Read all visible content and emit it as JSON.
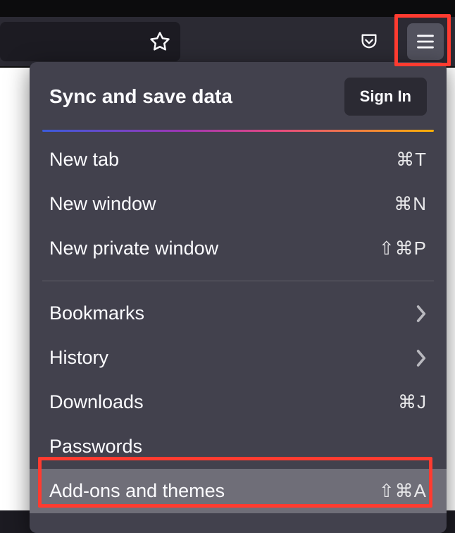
{
  "toolbar": {
    "star_icon": "star",
    "pocket_icon": "pocket",
    "menu_icon": "hamburger"
  },
  "menu": {
    "sync_title": "Sync and save data",
    "sign_in_label": "Sign In",
    "items_group1": [
      {
        "label": "New tab",
        "shortcut": "⌘T"
      },
      {
        "label": "New window",
        "shortcut": "⌘N"
      },
      {
        "label": "New private window",
        "shortcut": "⇧⌘P"
      }
    ],
    "items_group2": [
      {
        "label": "Bookmarks",
        "submenu": true
      },
      {
        "label": "History",
        "submenu": true
      },
      {
        "label": "Downloads",
        "shortcut": "⌘J"
      },
      {
        "label": "Passwords"
      },
      {
        "label": "Add-ons and themes",
        "shortcut": "⇧⌘A",
        "highlighted": true
      }
    ]
  },
  "annotations": {
    "highlight_color": "#ff3b30"
  }
}
